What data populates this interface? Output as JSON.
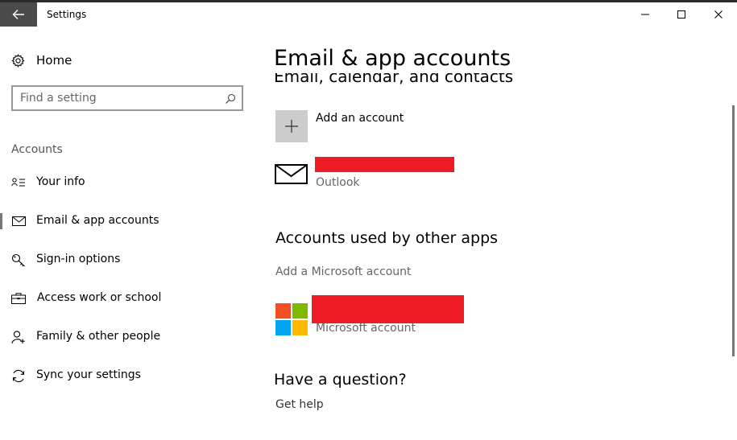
{
  "window": {
    "title": "Settings",
    "minimize_glyph": "—",
    "maximize_glyph": "☐",
    "close_glyph": "✕"
  },
  "sidebar": {
    "home_label": "Home",
    "search_placeholder": "Find a setting",
    "section_header": "Accounts",
    "items": [
      {
        "label": "Your info",
        "icon": "contact-info-icon"
      },
      {
        "label": "Email & app accounts",
        "icon": "mail-icon",
        "active": true
      },
      {
        "label": "Sign-in options",
        "icon": "key-icon"
      },
      {
        "label": "Access work or school",
        "icon": "briefcase-icon"
      },
      {
        "label": "Family & other people",
        "icon": "add-person-icon"
      },
      {
        "label": "Sync your settings",
        "icon": "sync-icon"
      }
    ]
  },
  "main": {
    "page_title": "Email & app accounts",
    "email_section_title": "Email, calendar, and contacts",
    "add_account_label": "Add an account",
    "email_account": {
      "provider": "Outlook"
    },
    "other_apps_title": "Accounts used by other apps",
    "add_microsoft_account": "Add a Microsoft account",
    "microsoft_account": {
      "type": "Microsoft account"
    },
    "help_title": "Have a question?",
    "help_link": "Get help"
  },
  "colors": {
    "back_button_bg": "#4b4b4b",
    "redaction": "#ee1c24",
    "tile_gray": "#cccccc",
    "ms_red": "#f25022",
    "ms_green": "#7fba00",
    "ms_blue": "#00a4ef",
    "ms_yellow": "#ffb900"
  }
}
